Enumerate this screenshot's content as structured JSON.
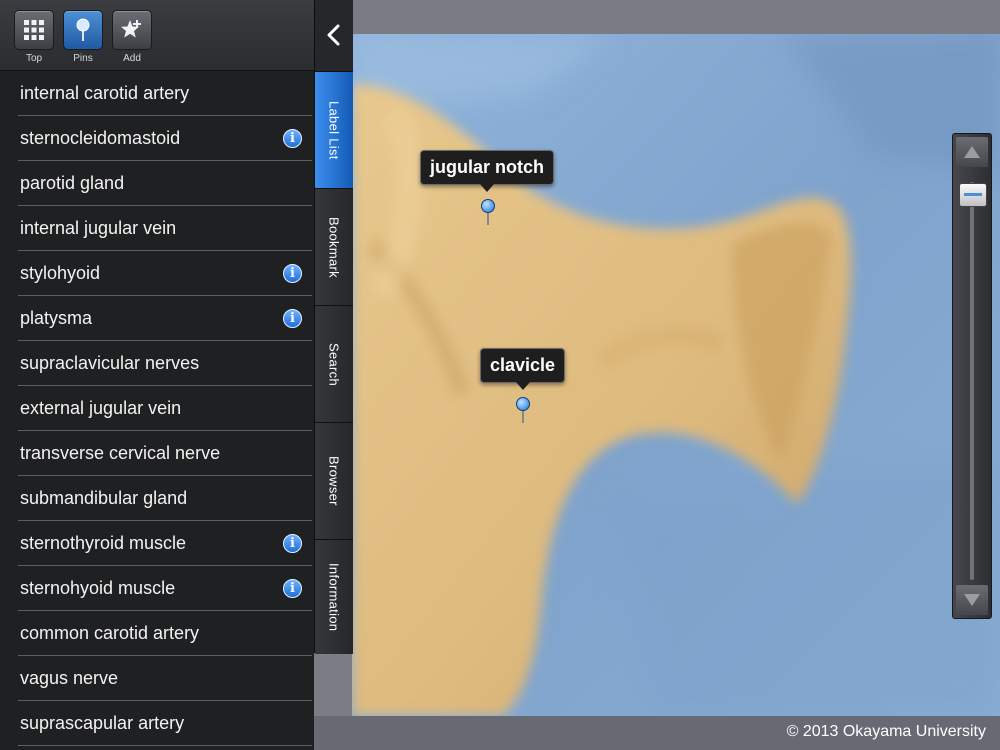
{
  "toolbar": {
    "buttons": [
      {
        "label": "Top",
        "icon": "grid-icon"
      },
      {
        "label": "Pins",
        "icon": "pin-icon"
      },
      {
        "label": "Add",
        "icon": "star-add-icon"
      }
    ],
    "active": "Pins"
  },
  "label_list": [
    {
      "label": "internal carotid artery",
      "info": false
    },
    {
      "label": "sternocleidomastoid",
      "info": true
    },
    {
      "label": "parotid gland",
      "info": false
    },
    {
      "label": "internal jugular vein",
      "info": false
    },
    {
      "label": "stylohyoid",
      "info": true
    },
    {
      "label": "platysma",
      "info": true
    },
    {
      "label": "supraclavicular nerves",
      "info": false
    },
    {
      "label": "external jugular vein",
      "info": false
    },
    {
      "label": "transverse cervical nerve",
      "info": false
    },
    {
      "label": "submandibular gland",
      "info": false
    },
    {
      "label": "sternothyroid muscle",
      "info": true
    },
    {
      "label": "sternohyoid muscle",
      "info": true
    },
    {
      "label": "common carotid artery",
      "info": false
    },
    {
      "label": "vagus nerve",
      "info": false
    },
    {
      "label": "suprascapular artery",
      "info": false
    }
  ],
  "info_glyph": "i",
  "tabs": {
    "label_list": "Label List",
    "bookmark": "Bookmark",
    "search": "Search",
    "browser": "Browser",
    "information": "Information",
    "active": "Label List"
  },
  "pins": {
    "jugular_notch": "jugular notch",
    "clavicle": "clavicle"
  },
  "zoom": {
    "level": 0.02
  },
  "footer": {
    "copyright": "© 2013 Okayama University"
  },
  "colors": {
    "accent": "#1f6fd8",
    "bone": "#e2be82",
    "drape": "#86a9d2"
  }
}
